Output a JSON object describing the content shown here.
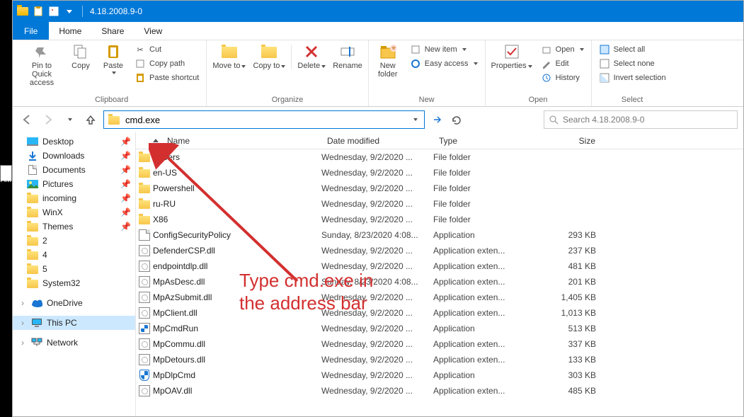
{
  "titlebar": {
    "title": "4.18.2008.9-0"
  },
  "menu": {
    "file": "File",
    "home": "Home",
    "share": "Share",
    "view": "View"
  },
  "ribbon": {
    "pin": "Pin to Quick access",
    "copy": "Copy",
    "paste": "Paste",
    "cut": "Cut",
    "copy_path": "Copy path",
    "paste_shortcut": "Paste shortcut",
    "clipboard": "Clipboard",
    "move_to": "Move to",
    "copy_to": "Copy to",
    "delete": "Delete",
    "rename": "Rename",
    "organize": "Organize",
    "new_folder": "New folder",
    "new_item": "New item",
    "easy_access": "Easy access",
    "new": "New",
    "properties": "Properties",
    "open": "Open",
    "edit": "Edit",
    "history": "History",
    "open_group": "Open",
    "select_all": "Select all",
    "select_none": "Select none",
    "invert": "Invert selection",
    "select": "Select"
  },
  "address": {
    "value": "cmd.exe"
  },
  "search": {
    "placeholder": "Search 4.18.2008.9-0"
  },
  "nav": {
    "desktop": "Desktop",
    "downloads": "Downloads",
    "documents": "Documents",
    "pictures": "Pictures",
    "incoming": "incoming",
    "winx": "WinX",
    "themes": "Themes",
    "two": "2",
    "four": "4",
    "five": "5",
    "system32": "System32",
    "onedrive": "OneDrive",
    "thispc": "This PC",
    "network": "Network"
  },
  "columns": {
    "name": "Name",
    "date": "Date modified",
    "type": "Type",
    "size": "Size"
  },
  "files": [
    {
      "name": "Drivers",
      "date": "Wednesday, 9/2/2020 ...",
      "type": "File folder",
      "size": "",
      "kind": "folder"
    },
    {
      "name": "en-US",
      "date": "Wednesday, 9/2/2020 ...",
      "type": "File folder",
      "size": "",
      "kind": "folder"
    },
    {
      "name": "Powershell",
      "date": "Wednesday, 9/2/2020 ...",
      "type": "File folder",
      "size": "",
      "kind": "folder"
    },
    {
      "name": "ru-RU",
      "date": "Wednesday, 9/2/2020 ...",
      "type": "File folder",
      "size": "",
      "kind": "folder"
    },
    {
      "name": "X86",
      "date": "Wednesday, 9/2/2020 ...",
      "type": "File folder",
      "size": "",
      "kind": "folder"
    },
    {
      "name": "ConfigSecurityPolicy",
      "date": "Sunday, 8/23/2020 4:08...",
      "type": "Application",
      "size": "293 KB",
      "kind": "exe"
    },
    {
      "name": "DefenderCSP.dll",
      "date": "Wednesday, 9/2/2020 ...",
      "type": "Application exten...",
      "size": "237 KB",
      "kind": "dll"
    },
    {
      "name": "endpointdlp.dll",
      "date": "Wednesday, 9/2/2020 ...",
      "type": "Application exten...",
      "size": "481 KB",
      "kind": "dll"
    },
    {
      "name": "MpAsDesc.dll",
      "date": "Sunday, 8/23/2020 4:08...",
      "type": "Application exten...",
      "size": "201 KB",
      "kind": "dll"
    },
    {
      "name": "MpAzSubmit.dll",
      "date": "Wednesday, 9/2/2020 ...",
      "type": "Application exten...",
      "size": "1,405 KB",
      "kind": "dll"
    },
    {
      "name": "MpClient.dll",
      "date": "Wednesday, 9/2/2020 ...",
      "type": "Application exten...",
      "size": "1,013 KB",
      "kind": "dll"
    },
    {
      "name": "MpCmdRun",
      "date": "Wednesday, 9/2/2020 ...",
      "type": "Application",
      "size": "513 KB",
      "kind": "exe2"
    },
    {
      "name": "MpCommu.dll",
      "date": "Wednesday, 9/2/2020 ...",
      "type": "Application exten...",
      "size": "337 KB",
      "kind": "dll"
    },
    {
      "name": "MpDetours.dll",
      "date": "Wednesday, 9/2/2020 ...",
      "type": "Application exten...",
      "size": "133 KB",
      "kind": "dll"
    },
    {
      "name": "MpDlpCmd",
      "date": "Wednesday, 9/2/2020 ...",
      "type": "Application",
      "size": "303 KB",
      "kind": "shield"
    },
    {
      "name": "MpOAV.dll",
      "date": "Wednesday, 9/2/2020 ...",
      "type": "Application exten...",
      "size": "485 KB",
      "kind": "dll"
    }
  ],
  "callout": {
    "line1": "Type cmd.exe in",
    "line2": "the address bar"
  }
}
